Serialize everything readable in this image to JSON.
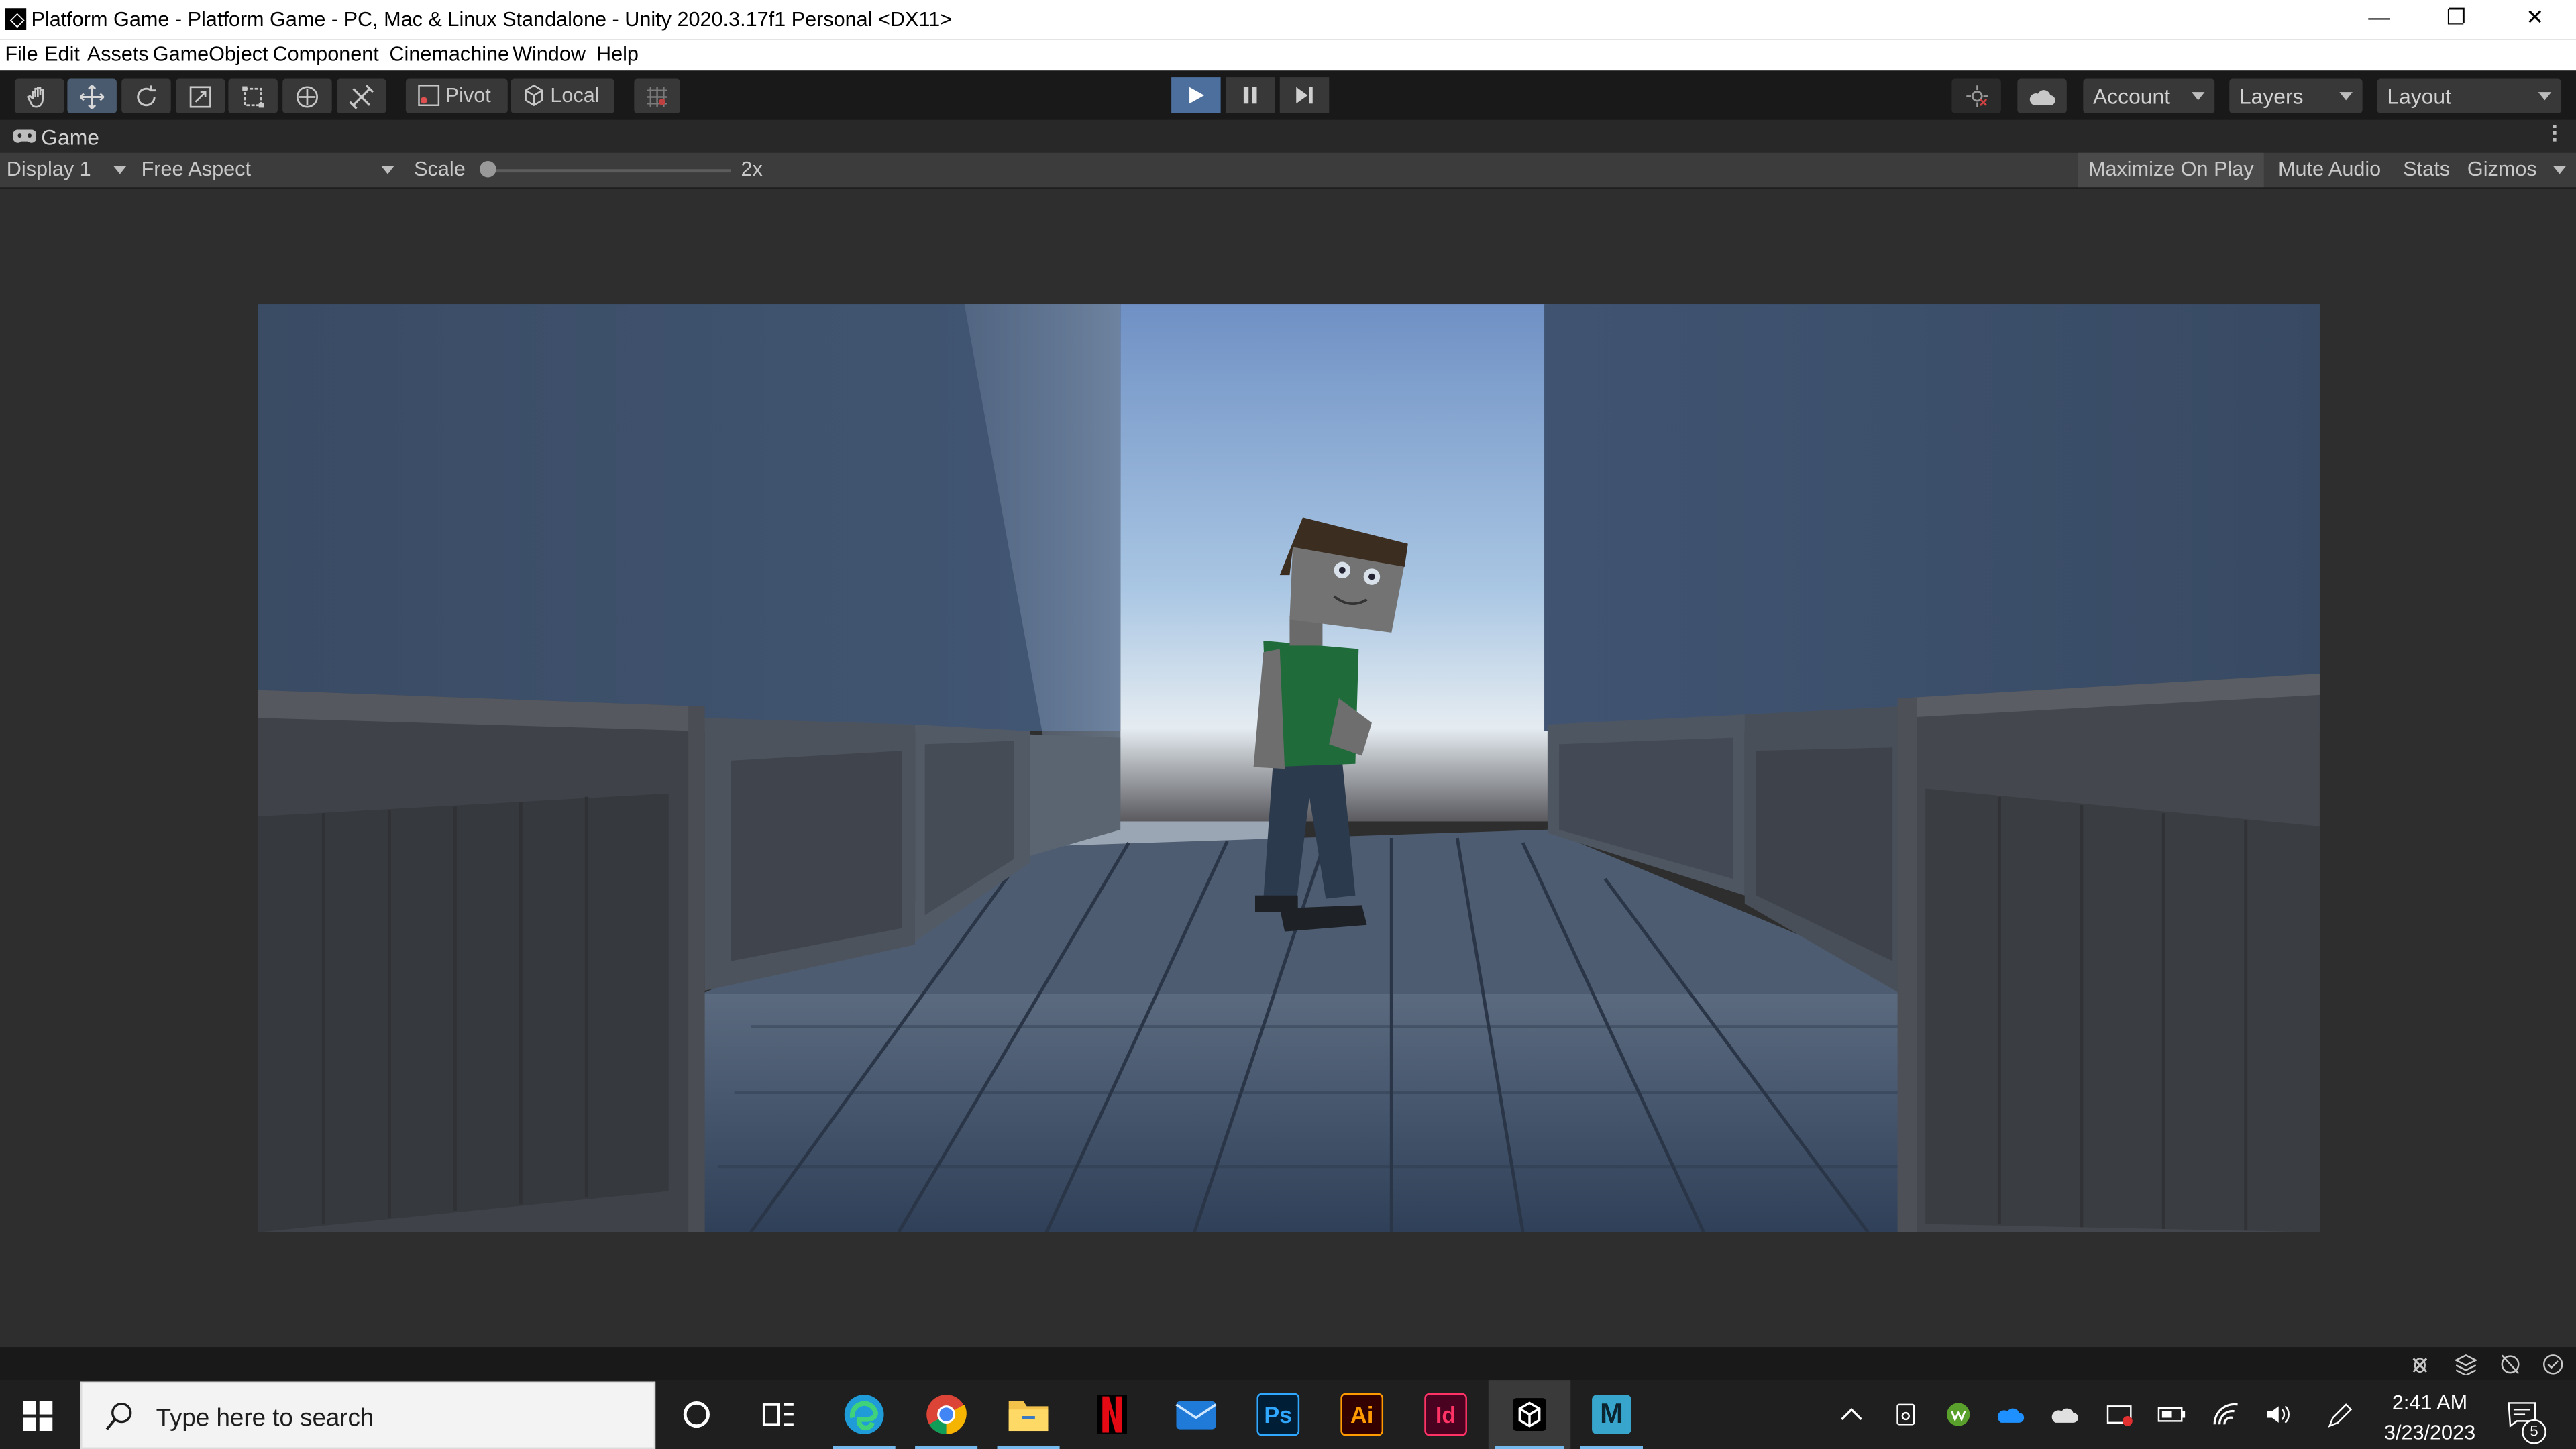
{
  "window": {
    "title": "Platform Game - Platform Game - PC, Mac & Linux Standalone - Unity 2020.3.17f1 Personal <DX11>",
    "controls": {
      "minimize": "—",
      "restore": "❐",
      "close": "✕"
    }
  },
  "menu": [
    "File",
    "Edit",
    "Assets",
    "GameObject",
    "Component",
    "Cinemachine",
    "Window",
    "Help"
  ],
  "toolbar": {
    "tools": [
      "hand-tool",
      "move-tool",
      "rotate-tool",
      "scale-tool",
      "rect-tool",
      "transform-tool",
      "custom-tool"
    ],
    "active_tool": "move-tool",
    "pivot_label": "Pivot",
    "local_label": "Local",
    "playback": {
      "playing": true
    },
    "account_label": "Account",
    "layers_label": "Layers",
    "layout_label": "Layout"
  },
  "game_tab": {
    "label": "Game"
  },
  "game_bar": {
    "display": "Display 1",
    "aspect": "Free Aspect",
    "scale_label": "Scale",
    "scale_value": "2x",
    "scale_slider_fraction": 0.0,
    "maximize_on_play": "Maximize On Play",
    "mute_audio": "Mute Audio",
    "stats": "Stats",
    "gizmos": "Gizmos"
  },
  "taskbar": {
    "search_placeholder": "Type here to search",
    "apps": [
      {
        "name": "cortana",
        "running": false
      },
      {
        "name": "task-view",
        "running": false
      },
      {
        "name": "edge",
        "running": true
      },
      {
        "name": "chrome",
        "running": true
      },
      {
        "name": "file-explorer",
        "running": true
      },
      {
        "name": "netflix",
        "running": false
      },
      {
        "name": "mail",
        "running": false
      },
      {
        "name": "photoshop",
        "running": false,
        "glyph": "Ps"
      },
      {
        "name": "illustrator",
        "running": false,
        "glyph": "Ai"
      },
      {
        "name": "indesign",
        "running": false,
        "glyph": "Id"
      },
      {
        "name": "unity",
        "running": true
      },
      {
        "name": "maya",
        "running": true,
        "glyph": "M"
      }
    ],
    "clock": {
      "time": "2:41 AM",
      "date": "3/23/2023"
    },
    "notification_count": "5"
  },
  "colors": {
    "editor_bg": "#282828",
    "toolbar_bg": "#191919",
    "play_active": "#4c6f9e",
    "taskbar_bg": "#1f1f1f"
  }
}
